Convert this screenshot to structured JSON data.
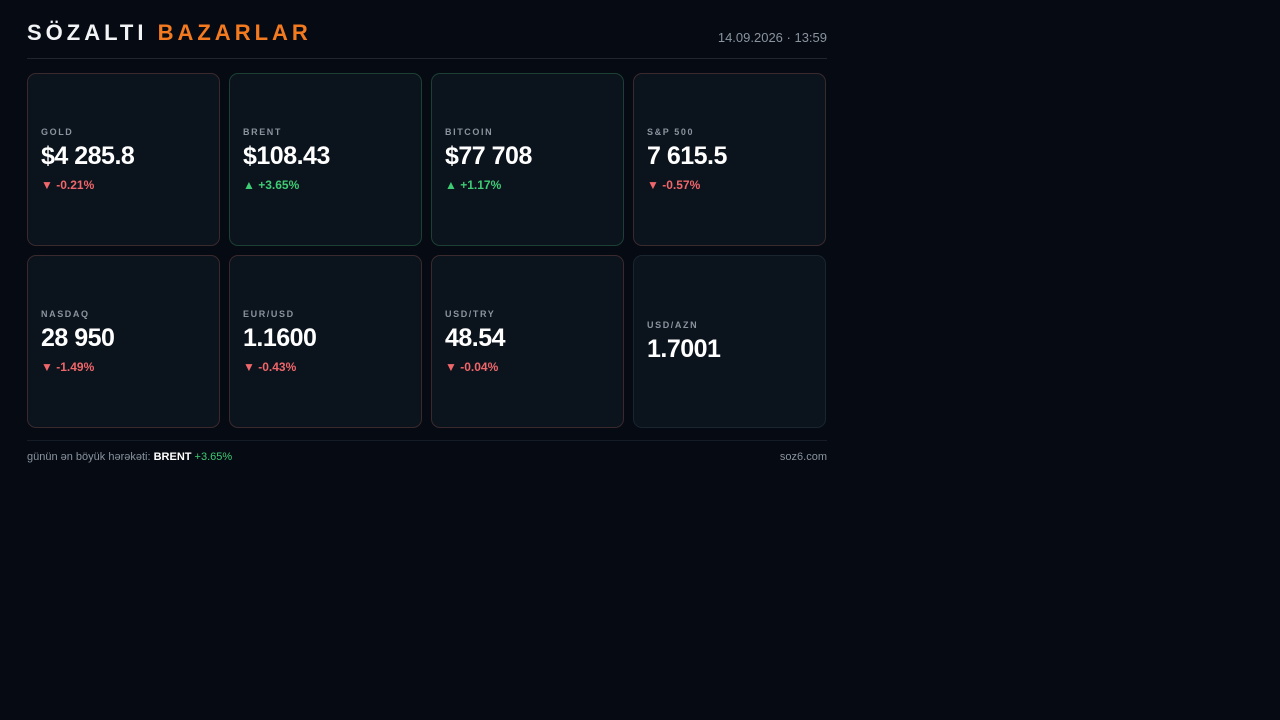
{
  "header": {
    "title_part1": "SÖZALTI",
    "title_part2": "BAZARLAR",
    "datetime": "14.09.2026 · 13:59"
  },
  "colors": {
    "accent": "#f47a20",
    "up": "#3ecb74",
    "down": "#f0666a",
    "background": "#060a12",
    "card": "#0b131c"
  },
  "cards": [
    {
      "symbol": "GOLD",
      "value": "$4 285.8",
      "change": "▼ -0.21%",
      "direction": "down"
    },
    {
      "symbol": "BRENT",
      "value": "$108.43",
      "change": "▲ +3.65%",
      "direction": "up"
    },
    {
      "symbol": "BITCOIN",
      "value": "$77 708",
      "change": "▲ +1.17%",
      "direction": "up"
    },
    {
      "symbol": "S&P 500",
      "value": "7 615.5",
      "change": "▼ -0.57%",
      "direction": "down"
    },
    {
      "symbol": "NASDAQ",
      "value": "28 950",
      "change": "▼ -1.49%",
      "direction": "down"
    },
    {
      "symbol": "EUR/USD",
      "value": "1.1600",
      "change": "▼ -0.43%",
      "direction": "down"
    },
    {
      "symbol": "USD/TRY",
      "value": "48.54",
      "change": "▼ -0.04%",
      "direction": "down"
    },
    {
      "symbol": "USD/AZN",
      "value": "1.7001",
      "change": "",
      "direction": "flat"
    }
  ],
  "footer": {
    "prefix": "günün ən böyük hərəkəti: ",
    "highlight_name": "BRENT",
    "highlight_change": "+3.65%",
    "site": "soz6.com"
  }
}
